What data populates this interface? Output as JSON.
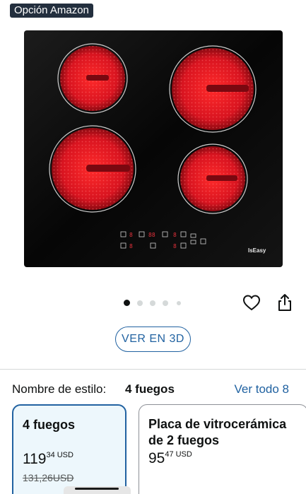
{
  "badge": {
    "label": "Opción Amazon"
  },
  "product_image": {
    "brand_text": "IsEasy",
    "control_digits": [
      "8",
      "88",
      "8",
      "8",
      "8",
      "8",
      "8"
    ]
  },
  "carousel": {
    "total": 5,
    "active_index": 0
  },
  "actions": {
    "favorite_icon": "heart-icon",
    "share_icon": "share-icon"
  },
  "view_3d": {
    "label": "VER EN 3D"
  },
  "style_selector": {
    "label": "Nombre de estilo:",
    "selected_value": "4 fuegos",
    "see_all": "Ver todo 8"
  },
  "options": [
    {
      "title": "4 fuegos",
      "price_whole": "119",
      "price_fraction": "34",
      "currency": "USD",
      "old_price": "131,26USD",
      "selected": true
    },
    {
      "title": "Placa de vitrocerámica de 2 fuegos",
      "price_whole": "95",
      "price_fraction": "47",
      "currency": "USD",
      "selected": false
    }
  ],
  "colors": {
    "accent": "#2162a1",
    "badge_bg": "#232f3e",
    "burner": "#c8102e"
  }
}
